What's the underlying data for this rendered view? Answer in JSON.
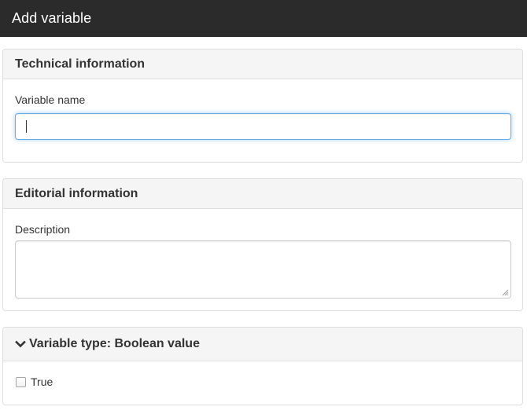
{
  "window": {
    "title": "Add variable"
  },
  "technical": {
    "heading": "Technical information",
    "variable_name_label": "Variable name",
    "variable_name_value": ""
  },
  "editorial": {
    "heading": "Editorial information",
    "description_label": "Description",
    "description_value": ""
  },
  "variable_type": {
    "heading": "Variable type: Boolean value",
    "expand_icon": "chevron-down-icon",
    "checkbox_label": "True",
    "checked": false
  },
  "colors": {
    "titlebar_bg": "#2b2b2b",
    "panel_heading_bg": "#f5f5f5",
    "focus_border": "#66afe9"
  }
}
